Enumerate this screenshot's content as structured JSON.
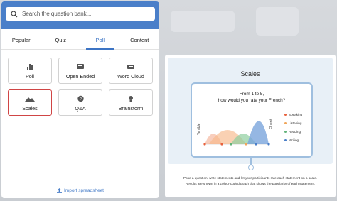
{
  "search": {
    "placeholder": "Search the question bank..."
  },
  "tabs": [
    {
      "label": "Popular",
      "active": false
    },
    {
      "label": "Quiz",
      "active": false
    },
    {
      "label": "Poll",
      "active": true
    },
    {
      "label": "Content",
      "active": false
    }
  ],
  "cards": [
    {
      "label": "Poll",
      "icon": "bar-chart-icon",
      "selected": false
    },
    {
      "label": "Open Ended",
      "icon": "card-icon",
      "selected": false
    },
    {
      "label": "Word Cloud",
      "icon": "cloud-icon",
      "selected": false
    },
    {
      "label": "Scales",
      "icon": "scales-icon",
      "selected": true
    },
    {
      "label": "Q&A",
      "icon": "qa-icon",
      "selected": false
    },
    {
      "label": "Brainstorm",
      "icon": "brainstorm-icon",
      "selected": false
    }
  ],
  "import_label": "Import spreadsheet",
  "preview": {
    "title": "Scales",
    "question_line1": "From 1 to 5,",
    "question_line2": "how would you rate your French?",
    "axis_left": "Terrible",
    "axis_right": "Fluent",
    "legend": [
      {
        "label": "Speaking",
        "color": "#e8613c"
      },
      {
        "label": "Listening",
        "color": "#f0a55a"
      },
      {
        "label": "Reading",
        "color": "#62b37a"
      },
      {
        "label": "Writing",
        "color": "#4a7fc9"
      }
    ],
    "description_line1": "Pose a question, write statements and let your participants rate each statement on a scale.",
    "description_line2": "Results are shown in a colour-coded graph that shows the popularity of each statement."
  },
  "colors": {
    "accent": "#4a7fc9",
    "selected_border": "#d04545"
  }
}
